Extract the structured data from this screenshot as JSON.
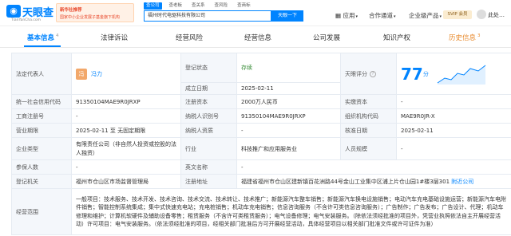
{
  "header": {
    "logo_text": "天眼查",
    "logo_url": "TianYanCha.com",
    "promo_line1": "国家中小企业发展子基金旗下机构",
    "promo_line2": "新华社推荐",
    "search_tabs": [
      "查公司",
      "查老板",
      "查关系",
      "查风险",
      "查商标"
    ],
    "search_value": "福州时代电驱科技有限公司",
    "search_button": "天眼一下",
    "nav_items": [
      "应用",
      "合作通道",
      "企业级产品"
    ],
    "svip": "SVIP 会员",
    "user_name": "此处…"
  },
  "tabs": [
    {
      "label": "基本信息",
      "count": "4"
    },
    {
      "label": "法律诉讼",
      "count": ""
    },
    {
      "label": "经营风险",
      "count": ""
    },
    {
      "label": "经营信息",
      "count": ""
    },
    {
      "label": "公司发展",
      "count": ""
    },
    {
      "label": "知识产权",
      "count": ""
    },
    {
      "label": "历史信息",
      "count": "3"
    }
  ],
  "fields": {
    "legal_rep_label": "法定代表人",
    "legal_rep_avatar": "冯",
    "legal_rep_name": "冯力",
    "reg_status_label": "登记状态",
    "reg_status": "存续",
    "score_label": "天眼评分",
    "score_value": "77",
    "score_unit": "分",
    "est_date_label": "成立日期",
    "est_date": "2025-02-11",
    "uscc_label": "统一社会信用代码",
    "uscc": "91350104MAE9R0JRXP",
    "reg_capital_label": "注册资本",
    "reg_capital": "2000万人民币",
    "paid_capital_label": "实缴资本",
    "paid_capital": "-",
    "reg_no_label": "工商注册号",
    "reg_no": "-",
    "taxpayer_id_label": "纳税人识别号",
    "taxpayer_id": "91350104MAE9R0JRXP",
    "org_code_label": "组织机构代码",
    "org_code": "MAE9R0JR-X",
    "term_label": "营业期限",
    "term": "2025-02-11 至 无固定期限",
    "taxpayer_quality_label": "纳税人资质",
    "taxpayer_quality": "-",
    "approval_date_label": "核准日期",
    "approval_date": "2025-02-11",
    "company_type_label": "企业类型",
    "company_type": "有限责任公司（非自然人投资或控股的法人独资）",
    "industry_label": "行业",
    "industry": "科技推广和应用服务业",
    "staff_size_label": "人员规模",
    "staff_size": "-",
    "insured_label": "参保人数",
    "insured": "-",
    "english_name_label": "英文名称",
    "english_name": "-",
    "authority_label": "登记机关",
    "authority": "福州市仓山区市场监督管理局",
    "address_label": "注册地址",
    "address": "福建省福州市仓山区建新镇百花洲路44号金山工业集中区浦上片仓山园1#楼3层301",
    "address_link": "附近公司",
    "scope_label": "经营范围",
    "scope": "一般项目：技术服务、技术开发、技术咨询、技术交流、技术转让、技术推广；新能源汽车整车销售；新能源汽车换电设施销售；电动汽车充电基础设施运营；新能源汽车电附件销售；智能控制系统集成；集中式快速充电站；充电桩销售；机动车充电销售；信息咨询服务（不含许可类信息咨询服务）；广告制作；广告发布；广告设计、代理；机动车修理和维护；计算机软硬件及辅助设备零售；租赁服务（不含许可类租赁服务）；电气设备修理；电气安装服务。（除依法须经批准的项目外，凭营业执照依法自主开展经营活动）许可项目：电气安装服务。（依法须经批准的项目，经相关部门批准后方可开展经营活动，具体经营项目以相关部门批准文件或许可证件为准）"
  },
  "colors": {
    "accent": "#0084ff",
    "status_green": "#3a8e3a",
    "history_orange": "#e88a2c"
  }
}
